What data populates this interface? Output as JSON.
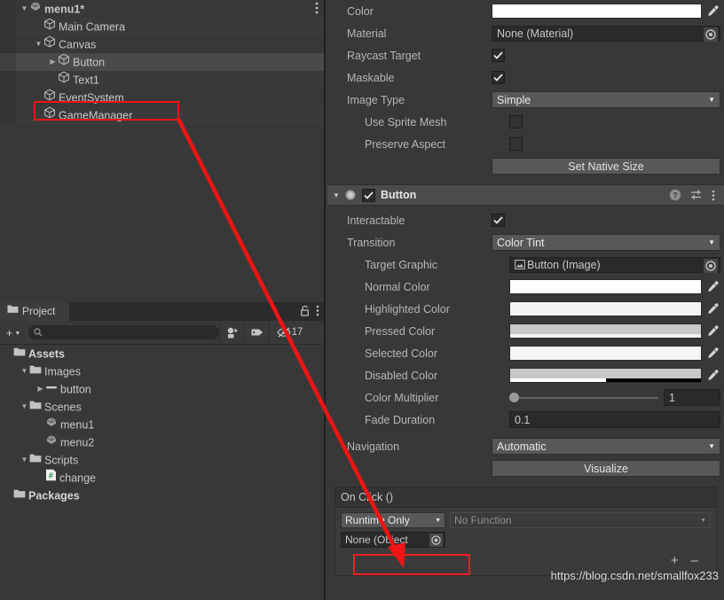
{
  "hierarchy": {
    "scene_name": "menu1*",
    "rows": [
      {
        "label": "menu1*",
        "depth": 1,
        "icon": "unity-scene-icon",
        "expanded": true,
        "selected": false,
        "alt": false,
        "bold": true
      },
      {
        "label": "Main Camera",
        "depth": 2,
        "icon": "gameobject-cube-icon",
        "expanded": null,
        "selected": false,
        "alt": true
      },
      {
        "label": "Canvas",
        "depth": 2,
        "icon": "gameobject-cube-icon",
        "expanded": true,
        "selected": false,
        "alt": false
      },
      {
        "label": "Button",
        "depth": 3,
        "icon": "gameobject-cube-icon",
        "expanded": false,
        "selected": true,
        "alt": false
      },
      {
        "label": "Text1",
        "depth": 3,
        "icon": "gameobject-cube-icon",
        "expanded": null,
        "selected": false,
        "alt": true
      },
      {
        "label": "EventSystem",
        "depth": 2,
        "icon": "gameobject-cube-icon",
        "expanded": null,
        "selected": false,
        "alt": false
      },
      {
        "label": "GameManager",
        "depth": 2,
        "icon": "gameobject-cube-icon",
        "expanded": null,
        "selected": false,
        "alt": true
      }
    ]
  },
  "project": {
    "tab_label": "Project",
    "lock_icon": "lock-open-icon",
    "menu_icon": "kebab-menu-icon",
    "toolbar": {
      "create_label": "+",
      "search_placeholder": "",
      "search_value": "",
      "search_icon": "search-icon",
      "filter_type_icon": "filter-by-type-icon",
      "filter_label_icon": "filter-by-label-icon",
      "hidden_packages_icon": "eye-crossed-icon",
      "hidden_packages_count": "17"
    },
    "rows": [
      {
        "label": "Assets",
        "depth": 0,
        "icon": "folder-icon",
        "expanded": null,
        "bold": true
      },
      {
        "label": "Images",
        "depth": 1,
        "icon": "folder-icon",
        "expanded": true,
        "bold": false
      },
      {
        "label": "button",
        "depth": 2,
        "icon": "sprite-icon",
        "expanded": false,
        "bold": false
      },
      {
        "label": "Scenes",
        "depth": 1,
        "icon": "folder-icon",
        "expanded": true,
        "bold": false
      },
      {
        "label": "menu1",
        "depth": 2,
        "icon": "unity-scene-icon",
        "expanded": null,
        "bold": false
      },
      {
        "label": "menu2",
        "depth": 2,
        "icon": "unity-scene-icon",
        "expanded": null,
        "bold": false
      },
      {
        "label": "Scripts",
        "depth": 1,
        "icon": "folder-icon",
        "expanded": true,
        "bold": false
      },
      {
        "label": "change",
        "depth": 2,
        "icon": "csharp-script-icon",
        "expanded": null,
        "bold": false
      },
      {
        "label": "Packages",
        "depth": 0,
        "icon": "folder-icon",
        "expanded": null,
        "bold": true
      }
    ]
  },
  "inspector": {
    "image_component": {
      "rows": [
        {
          "label": "Color",
          "type": "color",
          "color": "#ffffff",
          "alpha_color": "#ffffff",
          "indent": false
        },
        {
          "label": "Material",
          "type": "object",
          "value": "None (Material)",
          "indent": false
        },
        {
          "label": "Raycast Target",
          "type": "checkbox",
          "checked": true,
          "indent": false
        },
        {
          "label": "Maskable",
          "type": "checkbox",
          "checked": true,
          "indent": false
        },
        {
          "label": "Image Type",
          "type": "dropdown",
          "value": "Simple",
          "indent": false
        },
        {
          "label": "Use Sprite Mesh",
          "type": "checkbox",
          "checked": false,
          "indent": true
        },
        {
          "label": "Preserve Aspect",
          "type": "checkbox",
          "checked": false,
          "indent": true
        }
      ],
      "set_native_size_label": "Set Native Size"
    },
    "button_component": {
      "header": {
        "title": "Button",
        "enabled": true,
        "foldout_icon": "foldout-arrow-down-icon",
        "component_icon": "button-component-icon",
        "help_icon": "help-icon",
        "preset_icon": "preset-icon",
        "menu_icon": "kebab-menu-icon"
      },
      "rows": [
        {
          "label": "Interactable",
          "type": "checkbox",
          "checked": true,
          "indent": false
        },
        {
          "label": "Transition",
          "type": "dropdown",
          "value": "Color Tint",
          "indent": false
        },
        {
          "label": "Target Graphic",
          "type": "object",
          "value": "Button (Image)",
          "indent": true
        },
        {
          "label": "Normal Color",
          "type": "color",
          "color": "#ffffff",
          "alpha_color": "#ffffff",
          "indent": true
        },
        {
          "label": "Highlighted Color",
          "type": "color",
          "color": "#f5f5f5",
          "alpha_color": "#f5f5f5",
          "indent": true
        },
        {
          "label": "Pressed Color",
          "type": "color",
          "color": "#c8c8c8",
          "alpha_color": "#f2f2f2",
          "indent": true
        },
        {
          "label": "Selected Color",
          "type": "color",
          "color": "#f5f5f5",
          "alpha_color": "#f5f5f5",
          "indent": true
        },
        {
          "label": "Disabled Color",
          "type": "color",
          "color": "#c8c8c8",
          "alpha_color": "#ffffff",
          "alpha_pct": 50,
          "indent": true
        },
        {
          "label": "Color Multiplier",
          "type": "slider",
          "value": "1",
          "knob_pct": 0,
          "indent": true
        },
        {
          "label": "Fade Duration",
          "type": "text",
          "value": "0.1",
          "indent": true
        }
      ],
      "navigation": {
        "label": "Navigation",
        "value": "Automatic",
        "visualize_label": "Visualize"
      },
      "on_click": {
        "title": "On Click ()",
        "runtime_mode": "Runtime Only",
        "function": "No Function",
        "object": "None (Object",
        "add_label": "+",
        "remove_label": "–"
      }
    }
  },
  "watermark": "https://blog.csdn.net/smallfox233",
  "annotations": {
    "highlight_target": "GameManager",
    "arrow_color": "#f01414"
  }
}
